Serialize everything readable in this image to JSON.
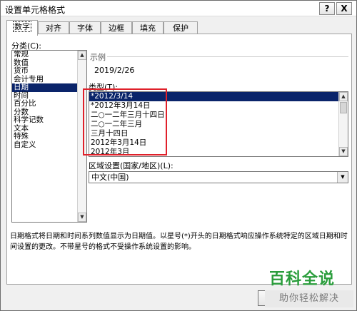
{
  "window": {
    "title": "设置单元格格式",
    "help_label": "?",
    "close_label": "X"
  },
  "tabs": [
    {
      "label": "数字",
      "active": true
    },
    {
      "label": "对齐",
      "active": false
    },
    {
      "label": "字体",
      "active": false
    },
    {
      "label": "边框",
      "active": false
    },
    {
      "label": "填充",
      "active": false
    },
    {
      "label": "保护",
      "active": false
    }
  ],
  "category": {
    "label": "分类(C):",
    "items": [
      "常规",
      "数值",
      "货币",
      "会计专用",
      "日期",
      "时间",
      "百分比",
      "分数",
      "科学记数",
      "文本",
      "特殊",
      "自定义"
    ],
    "selected": "日期"
  },
  "sample": {
    "label": "示例",
    "value": "2019/2/26"
  },
  "type": {
    "label": "类型(T):",
    "items": [
      "*2012/3/14",
      "*2012年3月14日",
      "二○一二年三月十四日",
      "二○一二年三月",
      "三月十四日",
      "2012年3月14日",
      "2012年3月"
    ],
    "selected": "*2012/3/14"
  },
  "locale": {
    "label": "区域设置(国家/地区)(L):",
    "value": "中文(中国)"
  },
  "description": "日期格式将日期和时间系列数值显示为日期值。以星号(*)开头的日期格式响应操作系统特定的区域日期和时间设置的更改。不带星号的格式不受操作系统设置的影响。",
  "watermark": {
    "main": "百科全说",
    "sub": "助你轻松解决"
  },
  "colors": {
    "selection": "#0a246a",
    "highlight": "#e0202a",
    "watermark": "#2a9d3c"
  }
}
